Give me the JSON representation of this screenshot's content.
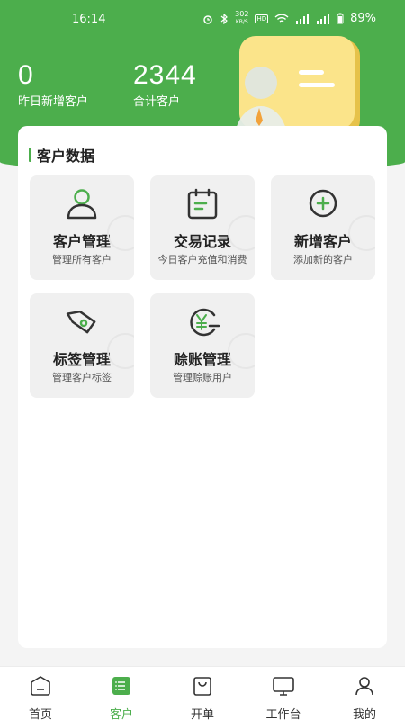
{
  "status": {
    "time": "16:14",
    "net_speed": "302",
    "net_unit": "KB/S",
    "hd": "HD",
    "battery": "89%"
  },
  "stats": [
    {
      "value": "0",
      "label": "昨日新增客户"
    },
    {
      "value": "2344",
      "label": "合计客户"
    }
  ],
  "section": {
    "title": "客户数据"
  },
  "tiles": [
    {
      "title": "客户管理",
      "sub": "管理所有客户",
      "icon": "user-icon"
    },
    {
      "title": "交易记录",
      "sub": "今日客户充值和消费",
      "icon": "calendar-icon"
    },
    {
      "title": "新增客户",
      "sub": "添加新的客户",
      "icon": "plus-circle-icon"
    },
    {
      "title": "标签管理",
      "sub": "管理客户标签",
      "icon": "tag-icon"
    },
    {
      "title": "赊账管理",
      "sub": "管理赊账用户",
      "icon": "yen-icon"
    }
  ],
  "tabs": [
    {
      "label": "首页",
      "icon": "home-icon"
    },
    {
      "label": "客户",
      "icon": "customer-icon",
      "active": true
    },
    {
      "label": "开单",
      "icon": "bag-icon"
    },
    {
      "label": "工作台",
      "icon": "monitor-icon"
    },
    {
      "label": "我的",
      "icon": "person-icon"
    }
  ],
  "colors": {
    "accent": "#4cae4c",
    "tile_bg": "#f0f0f0",
    "icon_stroke": "#333333"
  }
}
